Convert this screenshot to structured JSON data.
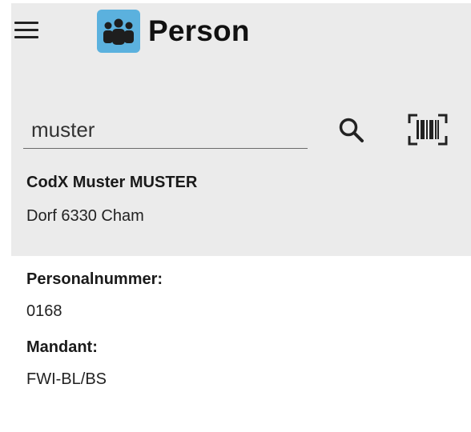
{
  "app": {
    "title": "Person",
    "icon": "people-group-icon",
    "icon_bg": "#5bb1de"
  },
  "toolbar": {
    "menu_icon": "hamburger-menu-icon",
    "search_icon": "search-icon",
    "barcode_icon": "barcode-scanner-icon"
  },
  "search": {
    "value": "muster"
  },
  "result": {
    "name": "CodX Muster MUSTER",
    "address": "Dorf 6330 Cham"
  },
  "details": {
    "personalnummer_label": "Personalnummer:",
    "personalnummer_value": "0168",
    "mandant_label": "Mandant:",
    "mandant_value": "FWI-BL/BS"
  },
  "colors": {
    "header_bg": "#ebebeb",
    "page_bg": "#ffffff"
  }
}
